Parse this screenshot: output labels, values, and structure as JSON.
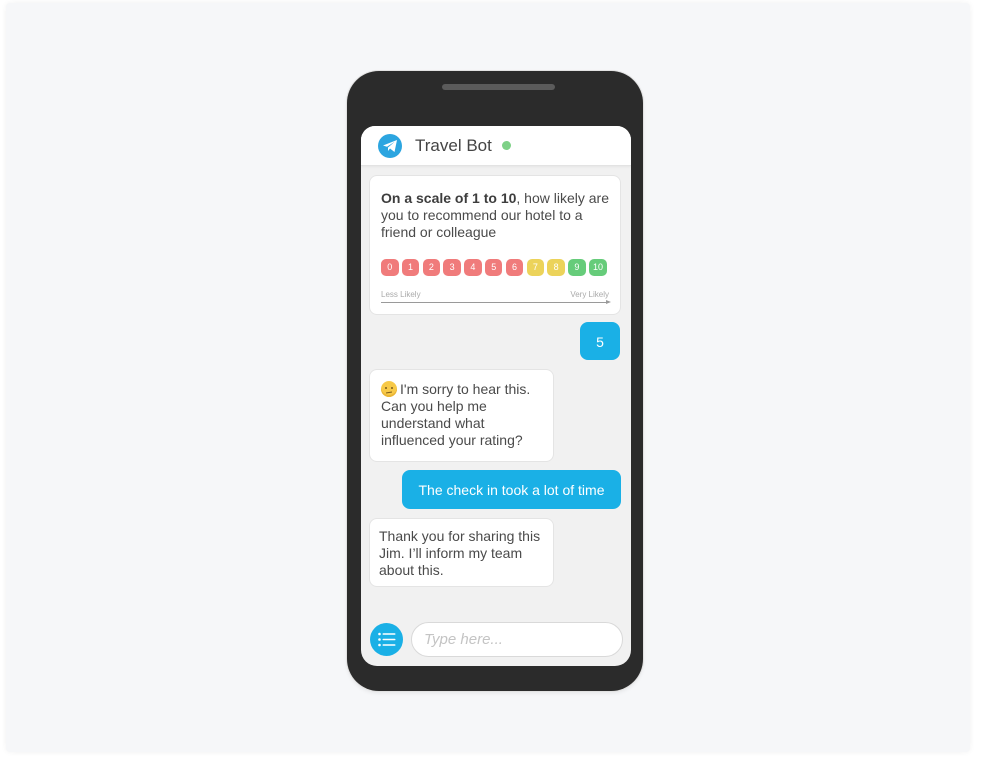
{
  "header": {
    "bot_name": "Travel Bot",
    "status": "online",
    "icon": "telegram-paper-plane-icon"
  },
  "messages": [
    {
      "sender": "bot",
      "type": "survey",
      "question_bold": "On a scale of 1 to 10",
      "question_rest": ", how likely are you to recommend our hotel to a friend or colleague",
      "scale": [
        {
          "label": "0",
          "color": "#f07b7b"
        },
        {
          "label": "1",
          "color": "#f07b7b"
        },
        {
          "label": "2",
          "color": "#f07b7b"
        },
        {
          "label": "3",
          "color": "#f07b7b"
        },
        {
          "label": "4",
          "color": "#f07b7b"
        },
        {
          "label": "5",
          "color": "#f07b7b"
        },
        {
          "label": "6",
          "color": "#f07b7b"
        },
        {
          "label": "7",
          "color": "#ecd35a"
        },
        {
          "label": "8",
          "color": "#ecd35a"
        },
        {
          "label": "9",
          "color": "#66cc7a"
        },
        {
          "label": "10",
          "color": "#66cc7a"
        }
      ],
      "scale_low_label": "Less Likely",
      "scale_high_label": "Very Likely"
    },
    {
      "sender": "user",
      "text": "5"
    },
    {
      "sender": "bot",
      "emoji": "confused-face",
      "text": "I'm sorry to hear this. Can you help me understand what influenced your rating?"
    },
    {
      "sender": "user",
      "text": "The check in took a lot of time"
    },
    {
      "sender": "bot",
      "text": "Thank you for sharing this Jim. I’ll inform my team about this."
    }
  ],
  "composer": {
    "placeholder": "Type here...",
    "menu_icon": "list-menu-icon"
  },
  "colors": {
    "accent": "#1ab0e6",
    "status_online": "#7ed187",
    "phone_frame": "#2b2b2b"
  }
}
